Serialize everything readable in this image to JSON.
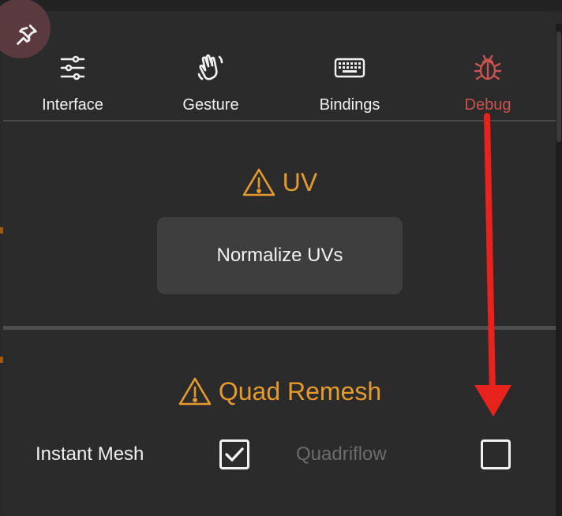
{
  "tabs": [
    {
      "label": "Interface",
      "icon": "sliders-icon"
    },
    {
      "label": "Gesture",
      "icon": "waving-hand-icon"
    },
    {
      "label": "Bindings",
      "icon": "keyboard-icon"
    },
    {
      "label": "Debug",
      "icon": "bug-icon",
      "active": true
    }
  ],
  "sections": {
    "uv": {
      "title": "UV",
      "button": "Normalize UVs"
    },
    "quad_remesh": {
      "title": "Quad Remesh",
      "options": [
        {
          "label": "Instant Mesh",
          "checked": true
        },
        {
          "label": "Quadriflow",
          "checked": false
        }
      ]
    }
  },
  "colors": {
    "accent_warning": "#e59a2c",
    "active_tab": "#c8534f",
    "annotation_arrow": "#e8221d",
    "pin_bg": "#5a3a3e"
  }
}
